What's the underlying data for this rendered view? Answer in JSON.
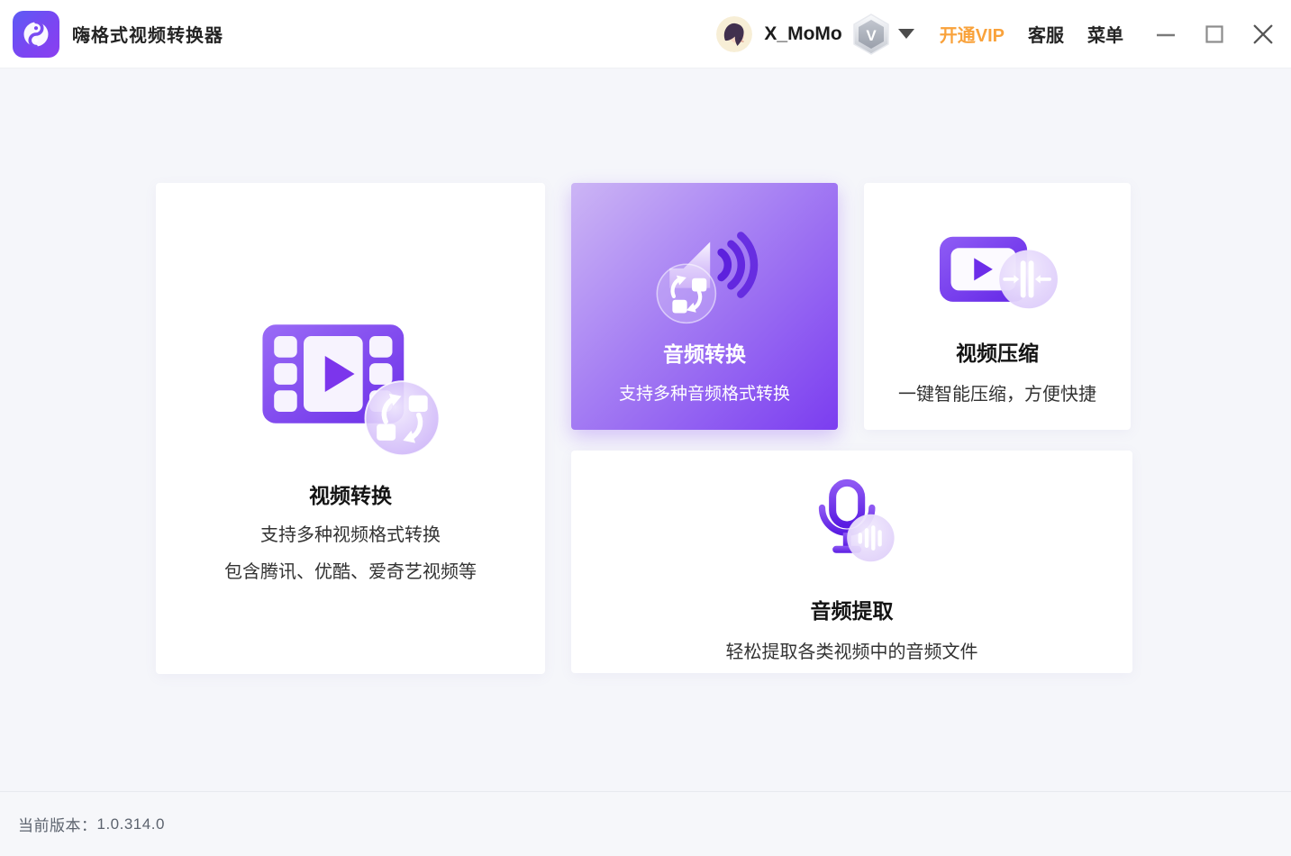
{
  "app": {
    "title": "嗨格式视频转换器"
  },
  "titlebar": {
    "username": "X_MoMo",
    "vip_badge_letter": "V",
    "vip_upgrade_label": "开通VIP",
    "support_label": "客服",
    "menu_label": "菜单"
  },
  "cards": {
    "video_convert": {
      "title": "视频转换",
      "desc1": "支持多种视频格式转换",
      "desc2": "包含腾讯、优酷、爱奇艺视频等"
    },
    "audio_convert": {
      "title": "音频转换",
      "desc1": "支持多种音频格式转换"
    },
    "video_compress": {
      "title": "视频压缩",
      "desc1": "一键智能压缩，方便快捷"
    },
    "audio_extract": {
      "title": "音频提取",
      "desc1": "轻松提取各类视频中的音频文件"
    }
  },
  "footer": {
    "version_label": "当前版本：",
    "version_value": "1.0.314.0"
  },
  "colors": {
    "accent_purple": "#7b3df0",
    "card_gradient_start": "#ccb5f5",
    "card_gradient_end": "#7b3df0",
    "vip_orange": "#f9a23b"
  }
}
